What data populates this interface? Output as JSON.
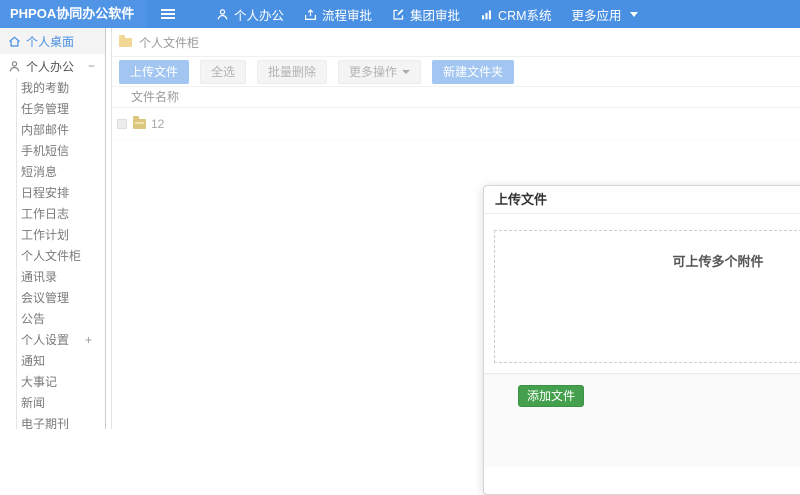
{
  "colors": {
    "navbar_bg": "#4a90e2",
    "brand_bg": "#5094e6",
    "accent_blue": "#4a90e2",
    "primary_button_bg": "#a2c6f1",
    "green_button_bg": "#44a04c",
    "folder_yellow": "#f2d894"
  },
  "navbar": {
    "brand": "PHPOA协同办公软件",
    "menu": [
      {
        "label": "个人办公",
        "icon": "user-icon"
      },
      {
        "label": "流程审批",
        "icon": "approval-icon"
      },
      {
        "label": "集团审批",
        "icon": "edit-icon"
      },
      {
        "label": "CRM系统",
        "icon": "bar-chart-icon"
      },
      {
        "label": "更多应用",
        "icon": "caret-down-icon"
      }
    ]
  },
  "sidebar": {
    "desktop_item": {
      "label": "个人桌面",
      "icon": "home-icon",
      "active": true
    },
    "group_header": {
      "label": "个人办公",
      "icon": "user-icon",
      "toggle": "−"
    },
    "items": [
      {
        "label": "我的考勤"
      },
      {
        "label": "任务管理"
      },
      {
        "label": "内部邮件"
      },
      {
        "label": "手机短信"
      },
      {
        "label": "短消息"
      },
      {
        "label": "日程安排"
      },
      {
        "label": "工作日志"
      },
      {
        "label": "工作计划"
      },
      {
        "label": "个人文件柜"
      },
      {
        "label": "通讯录"
      },
      {
        "label": "会议管理"
      },
      {
        "label": "公告"
      },
      {
        "label": "个人设置",
        "toggle": "+"
      },
      {
        "label": "通知"
      },
      {
        "label": "大事记"
      },
      {
        "label": "新闻"
      },
      {
        "label": "电子期刊"
      }
    ]
  },
  "main": {
    "breadcrumb": {
      "icon": "folder-icon",
      "label": "个人文件柜"
    },
    "toolbar": {
      "upload": "上传文件",
      "select_all": "全选",
      "batch_delete": "批量删除",
      "more_actions": "更多操作",
      "new_folder": "新建文件夹"
    },
    "table": {
      "name_header": "文件名称",
      "rows": [
        {
          "name": "12",
          "icon": "folder-icon"
        }
      ]
    }
  },
  "modal": {
    "title": "上传文件",
    "dropzone_hint": "可上传多个附件",
    "add_file_button": "添加文件"
  }
}
